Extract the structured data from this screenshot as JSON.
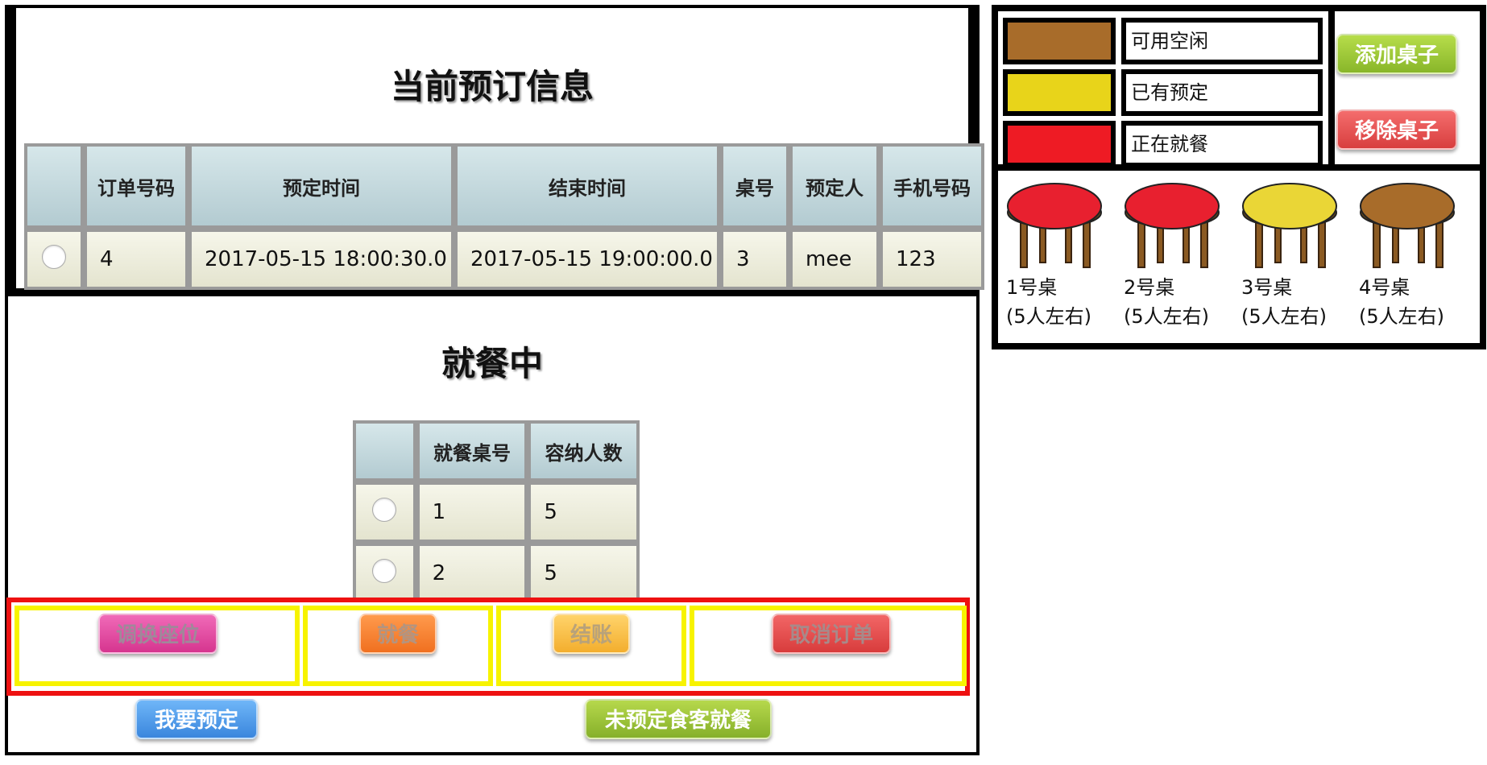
{
  "reservation": {
    "title": "当前预订信息",
    "columns": [
      "",
      "订单号码",
      "预定时间",
      "结束时间",
      "桌号",
      "预定人",
      "手机号码"
    ],
    "rows": [
      {
        "order_no": "4",
        "start": "2017-05-15 18:00:30.0",
        "end": "2017-05-15 19:00:00.0",
        "table": "3",
        "name": "mee",
        "phone": "123"
      }
    ]
  },
  "dining": {
    "title": "就餐中",
    "columns": [
      "",
      "就餐桌号",
      "容纳人数"
    ],
    "rows": [
      {
        "table": "1",
        "capacity": "5"
      },
      {
        "table": "2",
        "capacity": "5"
      }
    ]
  },
  "actions": {
    "swap_seat": "调换座位",
    "dine": "就餐",
    "checkout": "结账",
    "cancel_order": "取消订单",
    "reserve": "我要预定",
    "walkin_dine": "未预定食客就餐"
  },
  "legend": {
    "items": [
      {
        "label": "可用空闲",
        "color": "#a86c2a"
      },
      {
        "label": "已有预定",
        "color": "#e8d41a"
      },
      {
        "label": "正在就餐",
        "color": "#ee1b24"
      }
    ],
    "add_table": "添加桌子",
    "remove_table": "移除桌子"
  },
  "tables": [
    {
      "name": "1号桌",
      "capacity": "(5人左右)",
      "status": "dining",
      "color": "#e8202f"
    },
    {
      "name": "2号桌",
      "capacity": "(5人左右)",
      "status": "dining",
      "color": "#e8202f"
    },
    {
      "name": "3号桌",
      "capacity": "(5人左右)",
      "status": "reserved",
      "color": "#ead636"
    },
    {
      "name": "4号桌",
      "capacity": "(5人左右)",
      "status": "available",
      "color": "#a86c2a"
    }
  ]
}
